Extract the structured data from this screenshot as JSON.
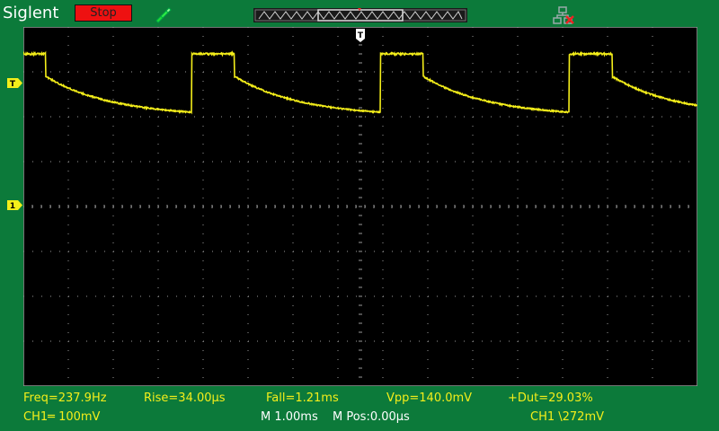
{
  "header": {
    "brand": "Siglent",
    "run_state": "Stop",
    "run_state_color": "#ee1111"
  },
  "icons": {
    "probe": "probe-icon",
    "network": "network-disconnected-icon",
    "trigger_pos": "T",
    "trigger_level": "T",
    "channel1": "1"
  },
  "colors": {
    "background": "#0c7a3a",
    "screen": "#000000",
    "grid": "#9a9a9a",
    "trace": "#f4ee1a"
  },
  "measurements": {
    "freq": "Freq=237.9Hz",
    "rise": "Rise=34.00µs",
    "fall": "Fall=1.21ms",
    "vpp": "Vpp=140.0mV",
    "duty": "+Dut=29.03%"
  },
  "status": {
    "ch1_scale": "CH1═ 100mV",
    "timebase": "M 1.00ms",
    "mpos": "M Pos:0.00µs",
    "trigger": "CH1 \\272mV"
  },
  "chart_data": {
    "type": "line",
    "title": "",
    "xlabel": "",
    "ylabel": "",
    "xlim": [
      -7.5,
      7.5
    ],
    "ylim": [
      -4,
      4
    ],
    "x_unit": "ms",
    "y_unit": "div",
    "grid": true,
    "series": [
      {
        "name": "",
        "period_ms": 4.2,
        "high_duration_ms": 0.95,
        "high_level_div": 3.4,
        "fall_start_div": 2.9,
        "low_end_div": 2.1,
        "first_rise_ms": -3.75
      }
    ]
  }
}
